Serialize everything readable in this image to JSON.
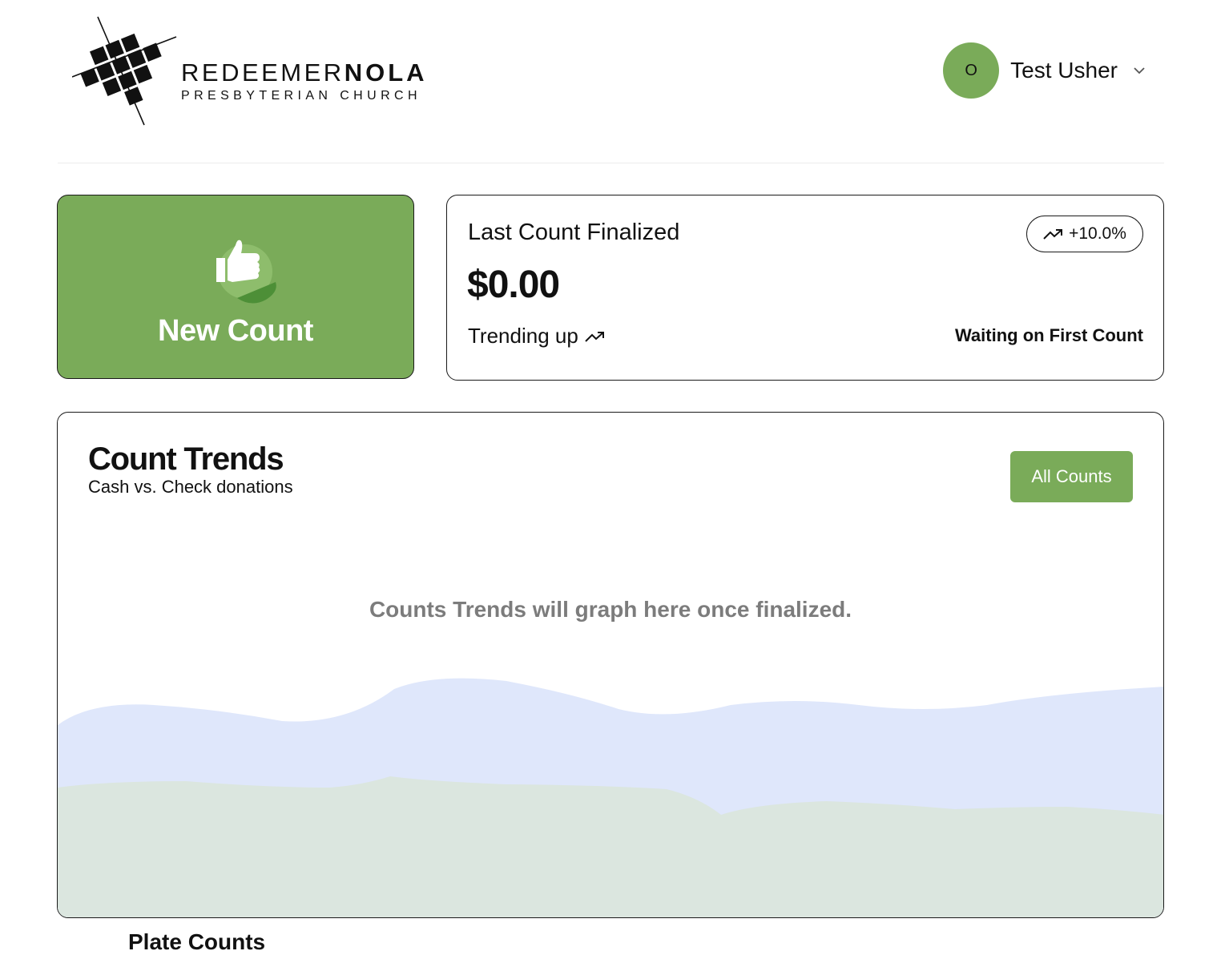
{
  "brand": {
    "name_light": "REDEEMER",
    "name_bold": "NOLA",
    "subtitle": "PRESBYTERIAN CHURCH"
  },
  "user": {
    "initial": "O",
    "name": "Test Usher"
  },
  "new_count": {
    "label": "New Count"
  },
  "last_count": {
    "title": "Last Count Finalized",
    "amount": "$0.00",
    "trend_label": "Trending up",
    "badge": "+10.0%",
    "status": "Waiting on First Count"
  },
  "count_trends": {
    "title": "Count Trends",
    "subtitle": "Cash vs. Check donations",
    "all_counts_label": "All Counts",
    "empty_message": "Counts Trends will graph here once finalized.",
    "colors": {
      "cash_area": "#dfe7fb",
      "check_area": "#dbe6df"
    }
  },
  "next_section": {
    "title": "Plate Counts"
  },
  "colors": {
    "accent": "#7aab59",
    "accent_dark": "#4d8f37"
  }
}
